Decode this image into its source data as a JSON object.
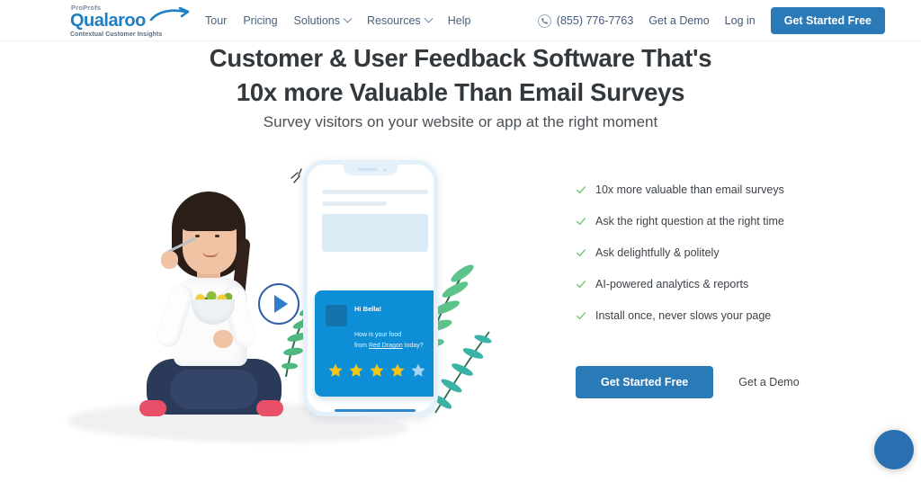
{
  "header": {
    "logo": {
      "brand_parent": "ProProfs",
      "brand": "Qualaroo",
      "tagline": "Contextual Customer Insights"
    },
    "nav": [
      {
        "label": "Tour",
        "has_dropdown": false
      },
      {
        "label": "Pricing",
        "has_dropdown": false
      },
      {
        "label": "Solutions",
        "has_dropdown": true
      },
      {
        "label": "Resources",
        "has_dropdown": true
      },
      {
        "label": "Help",
        "has_dropdown": false
      }
    ],
    "phone": "(855) 776-7763",
    "demo_link": "Get a Demo",
    "login_link": "Log in",
    "cta_button": "Get Started Free"
  },
  "hero": {
    "title_line1": "Customer & User Feedback Software That's",
    "title_line2": "10x more Valuable Than Email Surveys",
    "subtitle": "Survey visitors on your website or app at the right moment"
  },
  "features": [
    "10x more valuable than email surveys",
    "Ask the right question at the right time",
    "Ask delightfully & politely",
    "AI-powered analytics & reports",
    "Install once, never slows your page"
  ],
  "cta": {
    "primary": "Get Started Free",
    "secondary": "Get a Demo"
  },
  "survey_card": {
    "greeting": "Hi Bella!",
    "question_part1": "How is your food",
    "question_part2_pre": "from ",
    "question_brand": "Red Dragon",
    "question_part2_post": " today?",
    "rating_filled": 4,
    "rating_total": 5
  },
  "colors": {
    "brand_blue": "#1f7fc4",
    "button_blue": "#2a7ab8",
    "card_blue": "#0d8ed6",
    "check_green": "#6fc36f",
    "star_gold": "#f5c518",
    "star_empty": "#a7d4ef",
    "heading": "#33383d"
  }
}
